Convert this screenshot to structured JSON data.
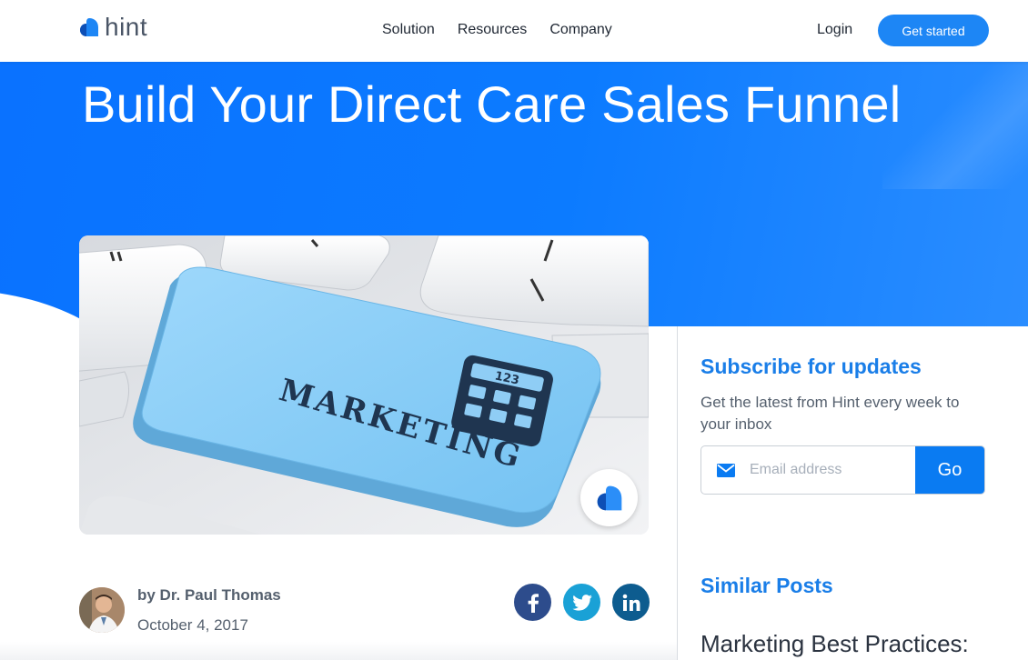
{
  "brand": {
    "name": "hint",
    "accent": "#1d86f5",
    "hero_blue": "#0c7bff"
  },
  "nav": {
    "items": [
      {
        "label": "Solution"
      },
      {
        "label": "Resources"
      },
      {
        "label": "Company"
      }
    ],
    "login_label": "Login",
    "cta_label": "Get started"
  },
  "hero": {
    "title": "Build Your Direct Care Sales Funnel"
  },
  "feature_image": {
    "alt_subject": "keyboard-marketing-key",
    "key_text": "MARKETING",
    "calculator_text": "123"
  },
  "author": {
    "byline": "by Dr. Paul Thomas",
    "date": "October 4, 2017"
  },
  "social": [
    {
      "icon": "facebook-icon",
      "glyph": "f",
      "color": "#2d4c8c"
    },
    {
      "icon": "twitter-icon",
      "glyph": "t",
      "color": "#1aa1d6"
    },
    {
      "icon": "linkedin-icon",
      "glyph": "in",
      "color": "#0d5c8f"
    }
  ],
  "subscribe": {
    "title": "Subscribe for updates",
    "text": "Get the latest from Hint every week to your inbox",
    "email_placeholder": "Email address",
    "button_label": "Go"
  },
  "similar": {
    "title": "Similar Posts",
    "first_post_title": "Marketing Best Practices:"
  }
}
